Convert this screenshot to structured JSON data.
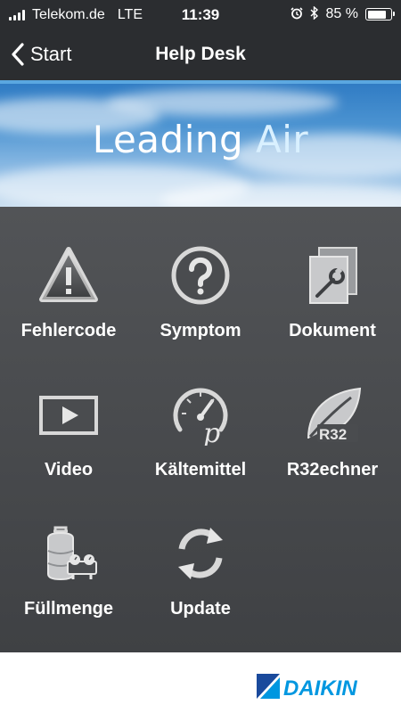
{
  "status_bar": {
    "carrier": "Telekom.de",
    "network": "LTE",
    "time": "11:39",
    "battery_percent": "85 %",
    "battery_level": 0.85
  },
  "nav": {
    "back_label": "Start",
    "title": "Help Desk"
  },
  "banner": {
    "word1": "Leading",
    "word2": "Air"
  },
  "menu": [
    {
      "label": "Fehlercode",
      "icon": "warning-triangle-icon"
    },
    {
      "label": "Symptom",
      "icon": "question-circle-icon"
    },
    {
      "label": "Dokument",
      "icon": "document-wrench-icon"
    },
    {
      "label": "Video",
      "icon": "play-icon"
    },
    {
      "label": "Kältemittel",
      "icon": "pressure-gauge-icon"
    },
    {
      "label": "R32echner",
      "icon": "r32-leaf-icon"
    },
    {
      "label": "Füllmenge",
      "icon": "refrigerant-cylinder-icon"
    },
    {
      "label": "Update",
      "icon": "refresh-icon"
    }
  ],
  "footer": {
    "brand": "DAIKIN"
  },
  "colors": {
    "bar": "#2b2d30",
    "grid_top": "#525457",
    "grid_bottom": "#3f4144",
    "brand_blue": "#0097e0",
    "brand_dark": "#1a4a9c"
  }
}
